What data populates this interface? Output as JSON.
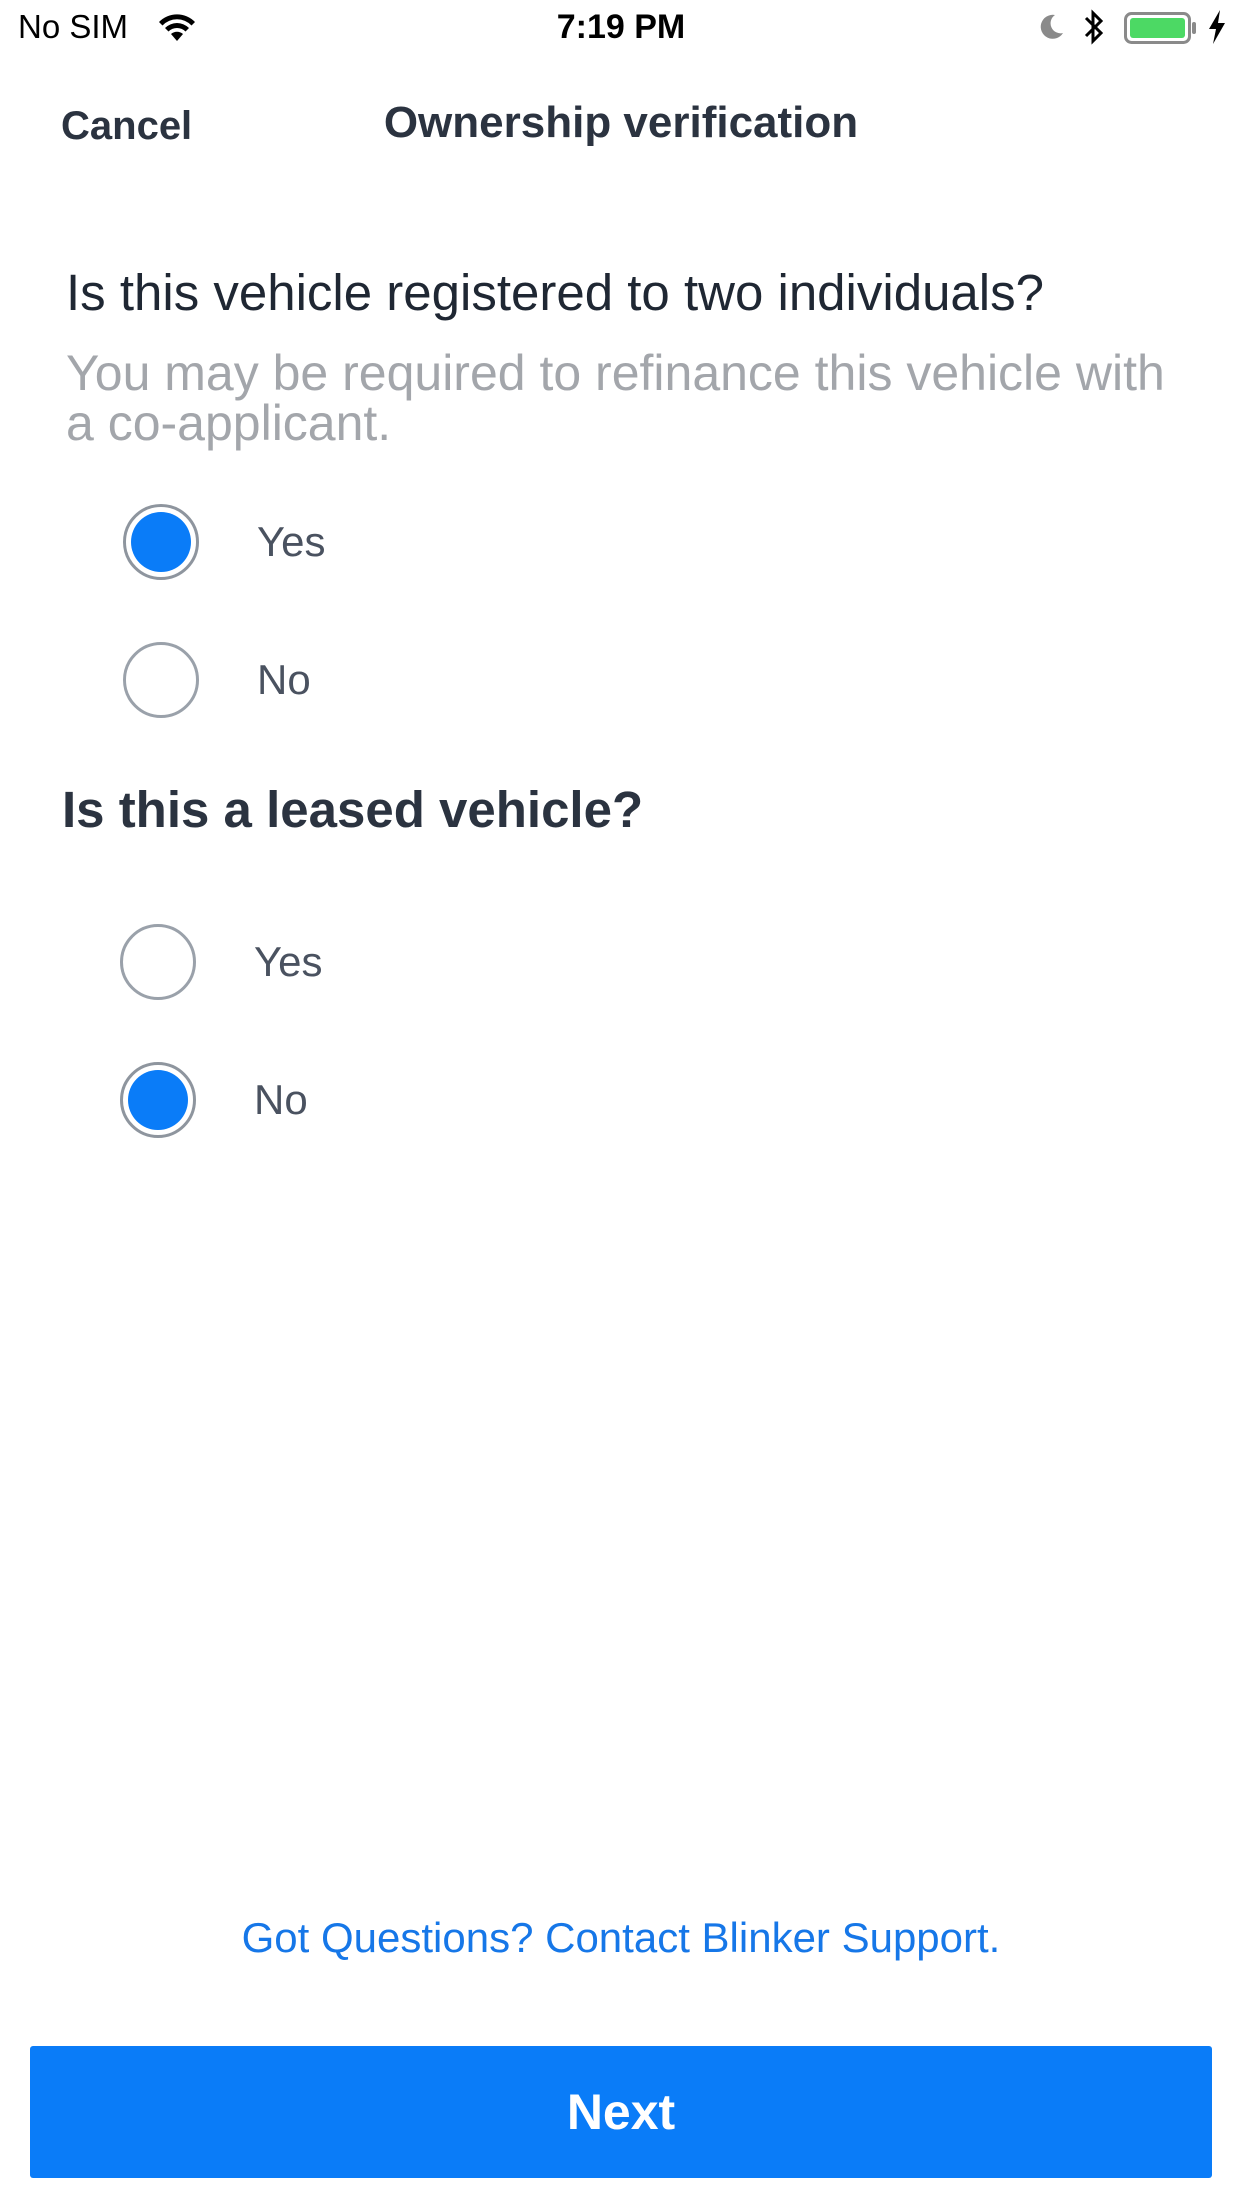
{
  "status_bar": {
    "carrier": "No SIM",
    "time": "7:19 PM",
    "battery_color": "#4cd964"
  },
  "nav": {
    "cancel_label": "Cancel",
    "title": "Ownership verification"
  },
  "question_registered": {
    "title": "Is this vehicle registered to two individuals?",
    "subtitle": "You may be required to refinance this vehicle with a co-applicant.",
    "options": [
      {
        "label": "Yes",
        "selected": true
      },
      {
        "label": "No",
        "selected": false
      }
    ]
  },
  "question_leased": {
    "title": "Is this a leased vehicle?",
    "options": [
      {
        "label": "Yes",
        "selected": false
      },
      {
        "label": "No",
        "selected": true
      }
    ]
  },
  "help": {
    "text": "Got Questions?  Contact Blinker Support."
  },
  "next_label": "Next",
  "colors": {
    "accent": "#0a7cf8",
    "link": "#1677e8",
    "text_dark": "#2b3340",
    "subtitle_gray": "#a3a6ab"
  }
}
